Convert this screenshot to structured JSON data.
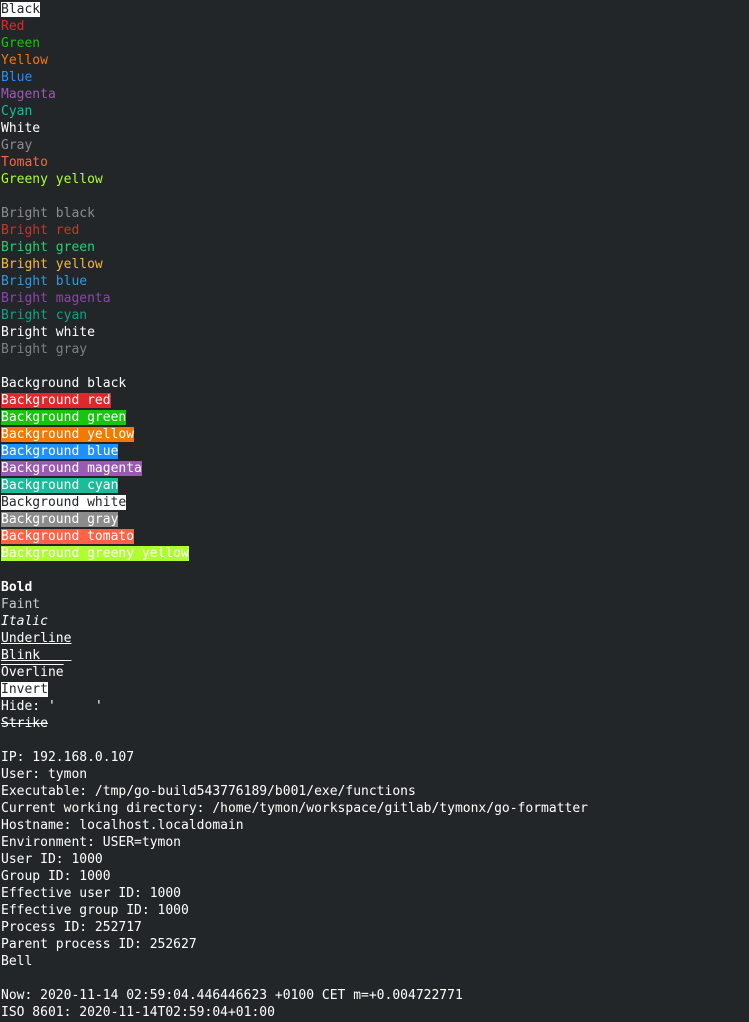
{
  "terminal": {
    "background": "#232628",
    "foreground": "#ffffff",
    "lines": [
      {
        "segments": [
          {
            "text": "Black",
            "fg": "#232628",
            "bg": "#ffffff"
          }
        ]
      },
      {
        "segments": [
          {
            "text": "Red",
            "fg": "#e2262a"
          }
        ]
      },
      {
        "segments": [
          {
            "text": "Green",
            "fg": "#16c60c"
          }
        ]
      },
      {
        "segments": [
          {
            "text": "Yellow",
            "fg": "#f57900"
          }
        ]
      },
      {
        "segments": [
          {
            "text": "Blue",
            "fg": "#1e90ff"
          }
        ]
      },
      {
        "segments": [
          {
            "text": "Magenta",
            "fg": "#9b59b6"
          }
        ]
      },
      {
        "segments": [
          {
            "text": "Cyan",
            "fg": "#1abc9c"
          }
        ]
      },
      {
        "segments": [
          {
            "text": "White",
            "fg": "#ffffff"
          }
        ]
      },
      {
        "segments": [
          {
            "text": "Gray",
            "fg": "#8c8c8c"
          }
        ]
      },
      {
        "segments": [
          {
            "text": "Tomato",
            "fg": "#ff6347"
          }
        ]
      },
      {
        "segments": [
          {
            "text": "Greeny yellow",
            "fg": "#adff2f"
          }
        ]
      },
      {
        "segments": [
          {
            "text": ""
          }
        ]
      },
      {
        "segments": [
          {
            "text": "Bright black",
            "fg": "#8c8c8c"
          }
        ]
      },
      {
        "segments": [
          {
            "text": "Bright red",
            "fg": "#c0392b"
          }
        ]
      },
      {
        "segments": [
          {
            "text": "Bright green",
            "fg": "#2ecc71"
          }
        ]
      },
      {
        "segments": [
          {
            "text": "Bright yellow",
            "fg": "#f6b93b"
          }
        ]
      },
      {
        "segments": [
          {
            "text": "Bright blue",
            "fg": "#3498db"
          }
        ]
      },
      {
        "segments": [
          {
            "text": "Bright magenta",
            "fg": "#8e44ad"
          }
        ]
      },
      {
        "segments": [
          {
            "text": "Bright cyan",
            "fg": "#16a085"
          }
        ]
      },
      {
        "segments": [
          {
            "text": "Bright white",
            "fg": "#ffffff"
          }
        ]
      },
      {
        "segments": [
          {
            "text": "Bright gray",
            "fg": "#7f7f7f"
          }
        ]
      },
      {
        "segments": [
          {
            "text": ""
          }
        ]
      },
      {
        "segments": [
          {
            "text": "Background black",
            "fg": "#ffffff",
            "bg": "#232628"
          }
        ]
      },
      {
        "segments": [
          {
            "text": "Background red",
            "fg": "#ffffff",
            "bg": "#e2262a"
          }
        ]
      },
      {
        "segments": [
          {
            "text": "Background green",
            "fg": "#ffffff",
            "bg": "#16c60c"
          }
        ]
      },
      {
        "segments": [
          {
            "text": "Background yellow",
            "fg": "#ffffff",
            "bg": "#f57900"
          }
        ]
      },
      {
        "segments": [
          {
            "text": "Background blue",
            "fg": "#ffffff",
            "bg": "#1e90ff"
          }
        ]
      },
      {
        "segments": [
          {
            "text": "Background magenta",
            "fg": "#ffffff",
            "bg": "#9b59b6"
          }
        ]
      },
      {
        "segments": [
          {
            "text": "Background cyan",
            "fg": "#ffffff",
            "bg": "#1abc9c"
          }
        ]
      },
      {
        "segments": [
          {
            "text": "Background white",
            "fg": "#232628",
            "bg": "#ffffff"
          }
        ]
      },
      {
        "segments": [
          {
            "text": "Background gray",
            "fg": "#ffffff",
            "bg": "#8c8c8c"
          }
        ]
      },
      {
        "segments": [
          {
            "text": "Background tomato",
            "fg": "#ffffff",
            "bg": "#ff6347"
          }
        ]
      },
      {
        "segments": [
          {
            "text": "Background greeny yellow",
            "fg": "#ffffff",
            "bg": "#adff2f"
          }
        ]
      },
      {
        "segments": [
          {
            "text": ""
          }
        ]
      },
      {
        "segments": [
          {
            "text": "Bold",
            "style": "bold"
          }
        ]
      },
      {
        "segments": [
          {
            "text": "Faint",
            "style": "faint"
          }
        ]
      },
      {
        "segments": [
          {
            "text": "Italic",
            "style": "italic"
          }
        ]
      },
      {
        "segments": [
          {
            "text": "Underline",
            "style": "underline"
          }
        ]
      },
      {
        "segments": [
          {
            "text": "Blink    ",
            "style": "blink-underline"
          }
        ]
      },
      {
        "segments": [
          {
            "text": "Overline",
            "style": "overline"
          }
        ]
      },
      {
        "segments": [
          {
            "text": "Invert",
            "fg": "#232628",
            "bg": "#ffffff"
          }
        ]
      },
      {
        "segments": [
          {
            "text": "Hide: '"
          },
          {
            "text": "     ",
            "style": "hidden-seg"
          },
          {
            "text": "'"
          }
        ]
      },
      {
        "segments": [
          {
            "text": "Strike",
            "style": "strike"
          }
        ]
      },
      {
        "segments": [
          {
            "text": ""
          }
        ]
      },
      {
        "segments": [
          {
            "text": "IP: 192.168.0.107"
          }
        ]
      },
      {
        "segments": [
          {
            "text": "User: tymon"
          }
        ]
      },
      {
        "segments": [
          {
            "text": "Executable: /tmp/go-build543776189/b001/exe/functions"
          }
        ]
      },
      {
        "segments": [
          {
            "text": "Current working directory: /home/tymon/workspace/gitlab/tymonx/go-formatter"
          }
        ]
      },
      {
        "segments": [
          {
            "text": "Hostname: localhost.localdomain"
          }
        ]
      },
      {
        "segments": [
          {
            "text": "Environment: USER=tymon"
          }
        ]
      },
      {
        "segments": [
          {
            "text": "User ID: 1000"
          }
        ]
      },
      {
        "segments": [
          {
            "text": "Group ID: 1000"
          }
        ]
      },
      {
        "segments": [
          {
            "text": "Effective user ID: 1000"
          }
        ]
      },
      {
        "segments": [
          {
            "text": "Effective group ID: 1000"
          }
        ]
      },
      {
        "segments": [
          {
            "text": "Process ID: 252717"
          }
        ]
      },
      {
        "segments": [
          {
            "text": "Parent process ID: 252627"
          }
        ]
      },
      {
        "segments": [
          {
            "text": "Bell"
          }
        ]
      },
      {
        "segments": [
          {
            "text": ""
          }
        ]
      },
      {
        "segments": [
          {
            "text": "Now: 2020-11-14 02:59:04.446446623 +0100 CET m=+0.004722771"
          }
        ]
      },
      {
        "segments": [
          {
            "text": "ISO 8601: 2020-11-14T02:59:04+01:00"
          }
        ]
      }
    ]
  }
}
